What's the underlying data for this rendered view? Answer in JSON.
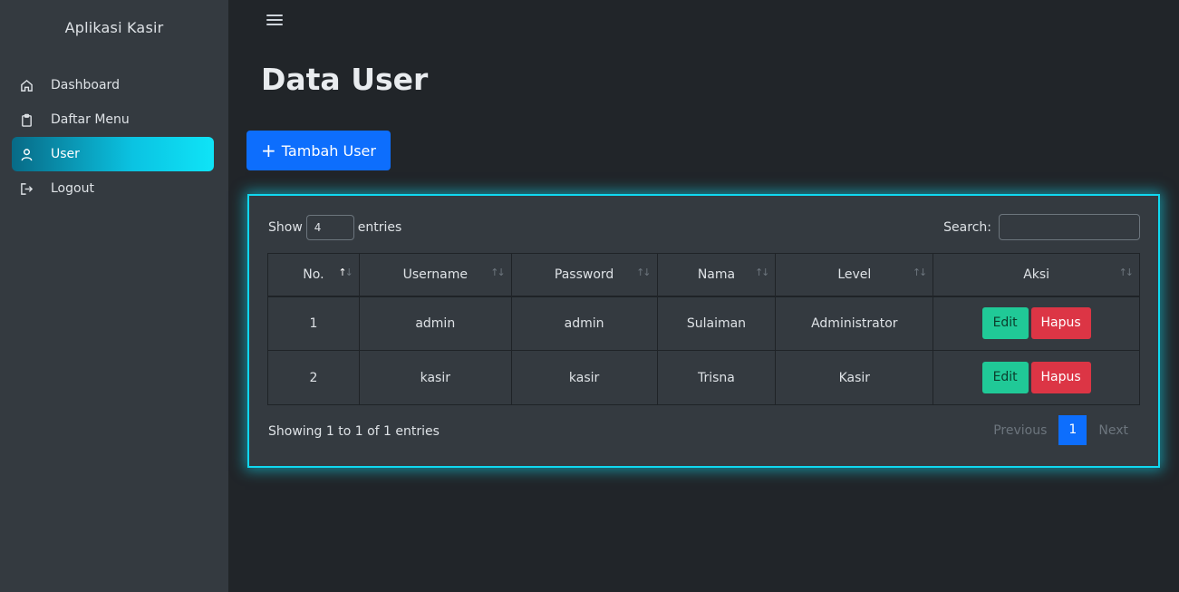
{
  "app": {
    "title": "Aplikasi Kasir"
  },
  "sidebar": {
    "items": [
      {
        "label": "Dashboard",
        "icon": "home-icon",
        "active": false
      },
      {
        "label": "Daftar Menu",
        "icon": "clipboard-icon",
        "active": false
      },
      {
        "label": "User",
        "icon": "user-icon",
        "active": true
      },
      {
        "label": "Logout",
        "icon": "logout-icon",
        "active": false
      }
    ]
  },
  "header": {
    "menu_icon": "hamburger-icon"
  },
  "page": {
    "title": "Data User",
    "add_button": "Tambah User"
  },
  "table_controls": {
    "show_label": "Show",
    "entries_value": "4",
    "entries_label": "entries",
    "search_label": "Search:",
    "search_value": ""
  },
  "table": {
    "columns": [
      "No.",
      "Username",
      "Password",
      "Nama",
      "Level",
      "Aksi"
    ],
    "rows": [
      {
        "no": "1",
        "username": "admin",
        "password": "admin",
        "nama": "Sulaiman",
        "level": "Administrator"
      },
      {
        "no": "2",
        "username": "kasir",
        "password": "kasir",
        "nama": "Trisna",
        "level": "Kasir"
      }
    ],
    "edit_label": "Edit",
    "delete_label": "Hapus"
  },
  "footer": {
    "info": "Showing 1 to 1 of 1 entries",
    "previous": "Previous",
    "current_page": "1",
    "next": "Next"
  },
  "colors": {
    "accent": "#0d6efd",
    "active_nav": "#0bc3e2",
    "card_glow": "#10d8f0",
    "edit": "#20c997",
    "delete": "#dc3545"
  }
}
